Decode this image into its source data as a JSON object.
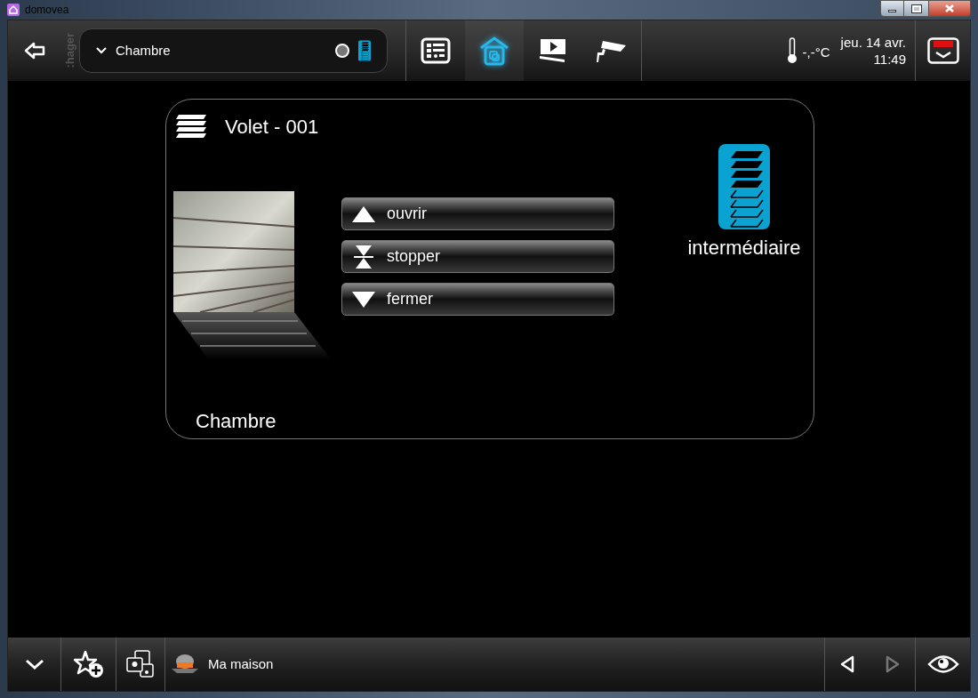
{
  "window": {
    "title": "domovea"
  },
  "header": {
    "brand": ":hager",
    "room": "Chambre",
    "nav": [
      {
        "kind": "list",
        "selected": false
      },
      {
        "kind": "home",
        "selected": true
      },
      {
        "kind": "media",
        "selected": false
      },
      {
        "kind": "camera",
        "selected": false
      }
    ],
    "temperature": "-,-°C",
    "date": "jeu. 14 avr.",
    "time": "11:49"
  },
  "device": {
    "title": "Volet - 001",
    "room": "Chambre",
    "actions": [
      {
        "kind": "up",
        "label": "ouvrir"
      },
      {
        "kind": "stop",
        "label": "stopper"
      },
      {
        "kind": "down",
        "label": "fermer"
      }
    ],
    "status": {
      "label": "intermédiaire"
    }
  },
  "footer": {
    "breadcrumb": "Ma maison",
    "previous": {
      "disabled": false
    },
    "next": {
      "disabled": true
    }
  }
}
